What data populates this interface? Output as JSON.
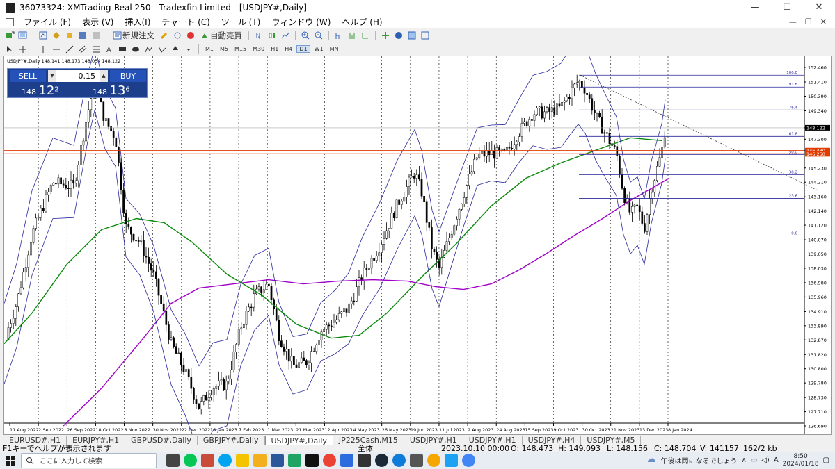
{
  "window": {
    "title": "36073324: XMTrading-Real 250 - Tradexfin Limited - [USDJPY#,Daily]",
    "controls": [
      "—",
      "☐",
      "✕"
    ]
  },
  "menu": {
    "items": [
      "ファイル (F)",
      "表示 (V)",
      "挿入(I)",
      "チャート (C)",
      "ツール (T)",
      "ウィンドウ (W)",
      "ヘルプ (H)"
    ],
    "right_controls": [
      "—",
      "❐",
      "✕"
    ]
  },
  "toolbar": {
    "new_order_label": "新規注文",
    "autotrade_label": "自動売買",
    "timeframes": [
      "M1",
      "M5",
      "M15",
      "M30",
      "H1",
      "H4",
      "D1",
      "W1",
      "MN"
    ],
    "active_timeframe": "D1"
  },
  "chart": {
    "info_line": "USDJPY#,Daily  148.141 148.173 148.034 148.122",
    "price_labels": [
      "152.460",
      "151.410",
      "150.390",
      "149.340",
      "148.122",
      "147.300",
      "146.480",
      "146.250",
      "145.230",
      "144.210",
      "143.160",
      "142.140",
      "141.120",
      "140.070",
      "139.050",
      "138.030",
      "136.980",
      "135.960",
      "134.910",
      "133.890",
      "132.870",
      "131.820",
      "130.800",
      "129.780",
      "128.730",
      "127.710",
      "126.690"
    ],
    "date_labels": [
      "11 Aug 2022",
      "2 Sep 2022",
      "26 Sep 2022",
      "18 Oct 2022",
      "8 Nov 2022",
      "30 Nov 2022",
      "22 Dec 2022",
      "16 Jan 2023",
      "7 Feb 2023",
      "1 Mar 2023",
      "21 Mar 2023",
      "12 Apr 2023",
      "4 May 2023",
      "26 May 2023",
      "19 Jun 2023",
      "11 Jul 2023",
      "2 Aug 2023",
      "24 Aug 2023",
      "15 Sep 2023",
      "9 Oct 2023",
      "30 Oct 2023",
      "21 Nov 2023",
      "13 Dec 2023",
      "8 Jan 2024"
    ],
    "fib_levels": [
      "100.0",
      "91.8",
      "76.4",
      "61.8",
      "50.0",
      "38.2",
      "23.6",
      "0.0"
    ],
    "current_price_label": "148.122",
    "red_line_labels": [
      "146.480",
      "146.250"
    ],
    "colors": {
      "candle": "#000000",
      "bollinger": "#27279a",
      "ma_green": "#0a8a0a",
      "ma_purple": "#a000c8",
      "fib": "#27279a",
      "red_lines": "#e03c00",
      "grid": "#000000"
    }
  },
  "trade_panel": {
    "sell_label": "SELL",
    "buy_label": "BUY",
    "lot": "0.15",
    "sell_price_prefix": "148",
    "sell_price_big": "12",
    "sell_price_sup": "2",
    "buy_price_prefix": "148",
    "buy_price_big": "13",
    "buy_price_sup": "6"
  },
  "tabs": [
    "EURUSD#,H1",
    "EURJPY#,H1",
    "GBPUSD#,Daily",
    "GBPJPY#,Daily",
    "USDJPY#,Daily",
    "JP225Cash,M15",
    "USDJPY#,H1",
    "USDJPY#,H1",
    "USDJPY#,H4",
    "USDJPY#,M5"
  ],
  "active_tab_index": 4,
  "status": {
    "help": "F1キーでヘルプが表示されます",
    "profile": "全体",
    "datetime": "2023.10.10 00:00",
    "open": "O: 148.473",
    "high": "H: 149.093",
    "low": "L: 148.156",
    "close": "C: 148.704",
    "volume": "V: 141157",
    "traffic": "162/2 kb"
  },
  "taskbar": {
    "search_placeholder": "ここに入力して検索",
    "weather": "午後は雨になるでしょう",
    "time": "8:50",
    "date": "2024/01/18"
  }
}
